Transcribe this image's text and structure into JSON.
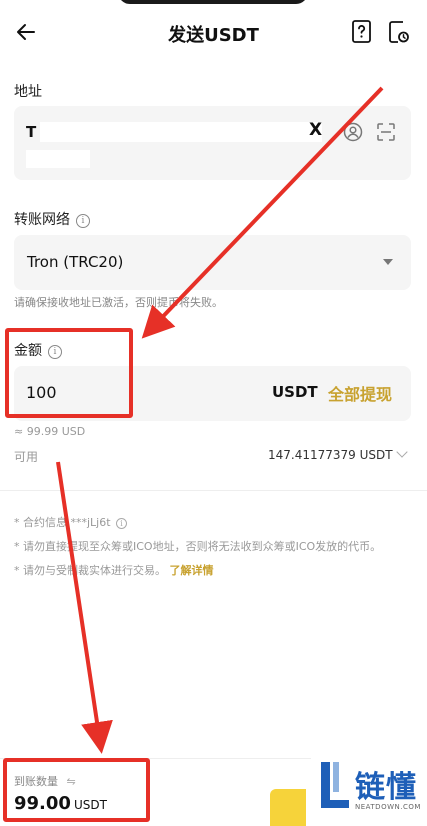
{
  "header": {
    "title": "发送USDT"
  },
  "address": {
    "label": "地址",
    "value": "T"
  },
  "network": {
    "label": "转账网络",
    "value": "Tron (TRC20)",
    "hint": "请确保接收地址已激活，否则提币将失败。"
  },
  "amount": {
    "label": "金额",
    "value": "100",
    "unit": "USDT",
    "max_label": "全部提现",
    "approx": "≈ 99.99 USD"
  },
  "available": {
    "label": "可用",
    "value": "147.41177379 USDT"
  },
  "notes": {
    "contract": "* 合约信息 ***jLj6t",
    "warning": "* 请勿直接提现至众筹或ICO地址，否则将无法收到众筹或ICO发放的代币。",
    "sanction": "* 请勿与受制裁实体进行交易。",
    "learn_more": "了解详情"
  },
  "receive": {
    "label": "到账数量",
    "value": "99.00",
    "unit": "USDT"
  },
  "watermark": {
    "brand": "链懂",
    "site": "NEATDOWN.COM"
  },
  "colors": {
    "accent": "#c8a230",
    "annotation": "#e63027",
    "field_bg": "#f5f5f5",
    "button": "#f6d33a"
  }
}
